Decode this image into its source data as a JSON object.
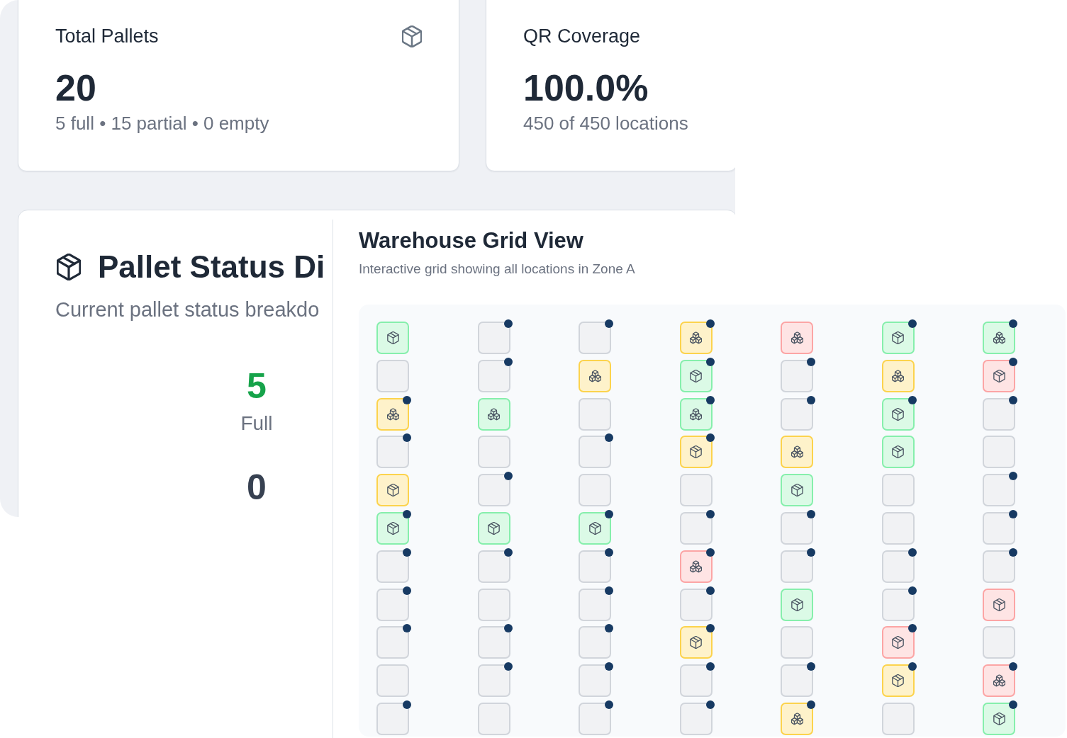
{
  "summary_cards": [
    {
      "title": "Total Pallets",
      "icon": true,
      "value": "20",
      "detail": "5 full • 15 partial • 0 empty"
    },
    {
      "title": "QR Coverage",
      "icon": false,
      "value": "100.0%",
      "detail": "450 of 450 locations"
    }
  ],
  "pallet_status": {
    "title": "Pallet Status Di",
    "subtitle": "Current pallet status breakdo",
    "stats": [
      {
        "value": "5",
        "label": "Full",
        "color": "#16a34a"
      },
      {
        "value": "0",
        "color": "#374151"
      }
    ]
  },
  "warehouse_grid": {
    "title": "Warehouse Grid View",
    "subtitle": "Interactive grid showing all locations in Zone A",
    "columns": [
      {
        "cells": [
          {
            "color": "#86efac",
            "kind": "box",
            "dot": false
          },
          {
            "color": "#d1d5db",
            "kind": "empty",
            "dot": false
          },
          {
            "color": "#fcd34d",
            "kind": "boxes",
            "dot": true
          },
          {
            "color": "#d1d5db",
            "kind": "empty",
            "dot": true
          },
          {
            "color": "#fcd34d",
            "kind": "box",
            "dot": false
          },
          {
            "color": "#86efac",
            "kind": "box",
            "dot": true
          },
          {
            "color": "#d1d5db",
            "kind": "empty",
            "dot": true
          },
          {
            "color": "#d1d5db",
            "kind": "empty",
            "dot": true
          },
          {
            "color": "#d1d5db",
            "kind": "empty",
            "dot": true
          },
          {
            "color": "#d1d5db",
            "kind": "empty",
            "dot": false
          },
          {
            "color": "#d1d5db",
            "kind": "empty",
            "dot": true
          }
        ]
      },
      {
        "cells": [
          {
            "color": "#d1d5db",
            "kind": "empty",
            "dot": true
          },
          {
            "color": "#d1d5db",
            "kind": "empty",
            "dot": true
          },
          {
            "color": "#86efac",
            "kind": "boxes",
            "dot": false
          },
          {
            "color": "#d1d5db",
            "kind": "empty",
            "dot": false
          },
          {
            "color": "#d1d5db",
            "kind": "empty",
            "dot": true
          },
          {
            "color": "#86efac",
            "kind": "box",
            "dot": false
          },
          {
            "color": "#d1d5db",
            "kind": "empty",
            "dot": true
          },
          {
            "color": "#d1d5db",
            "kind": "empty",
            "dot": false
          },
          {
            "color": "#d1d5db",
            "kind": "empty",
            "dot": true
          },
          {
            "color": "#d1d5db",
            "kind": "empty",
            "dot": true
          },
          {
            "color": "#d1d5db",
            "kind": "empty",
            "dot": false
          }
        ]
      },
      {
        "cells": [
          {
            "color": "#d1d5db",
            "kind": "empty",
            "dot": true
          },
          {
            "color": "#fcd34d",
            "kind": "boxes",
            "dot": false
          },
          {
            "color": "#d1d5db",
            "kind": "empty",
            "dot": false
          },
          {
            "color": "#d1d5db",
            "kind": "empty",
            "dot": true
          },
          {
            "color": "#d1d5db",
            "kind": "empty",
            "dot": false
          },
          {
            "color": "#86efac",
            "kind": "box",
            "dot": true
          },
          {
            "color": "#d1d5db",
            "kind": "empty",
            "dot": true
          },
          {
            "color": "#d1d5db",
            "kind": "empty",
            "dot": true
          },
          {
            "color": "#d1d5db",
            "kind": "empty",
            "dot": true
          },
          {
            "color": "#d1d5db",
            "kind": "empty",
            "dot": true
          },
          {
            "color": "#d1d5db",
            "kind": "empty",
            "dot": true
          }
        ]
      },
      {
        "cells": [
          {
            "color": "#fcd34d",
            "kind": "boxes",
            "dot": true
          },
          {
            "color": "#86efac",
            "kind": "box",
            "dot": true
          },
          {
            "color": "#86efac",
            "kind": "boxes",
            "dot": true
          },
          {
            "color": "#fcd34d",
            "kind": "box",
            "dot": true
          },
          {
            "color": "#d1d5db",
            "kind": "empty",
            "dot": false
          },
          {
            "color": "#d1d5db",
            "kind": "empty",
            "dot": true
          },
          {
            "color": "#fca5a5",
            "kind": "boxes",
            "dot": true
          },
          {
            "color": "#d1d5db",
            "kind": "empty",
            "dot": true
          },
          {
            "color": "#fcd34d",
            "kind": "box",
            "dot": true
          },
          {
            "color": "#d1d5db",
            "kind": "empty",
            "dot": true
          },
          {
            "color": "#d1d5db",
            "kind": "empty",
            "dot": true
          }
        ]
      },
      {
        "cells": [
          {
            "color": "#fca5a5",
            "kind": "boxes",
            "dot": false
          },
          {
            "color": "#d1d5db",
            "kind": "empty",
            "dot": true
          },
          {
            "color": "#d1d5db",
            "kind": "empty",
            "dot": true
          },
          {
            "color": "#fcd34d",
            "kind": "boxes",
            "dot": false
          },
          {
            "color": "#86efac",
            "kind": "box",
            "dot": false
          },
          {
            "color": "#d1d5db",
            "kind": "empty",
            "dot": true
          },
          {
            "color": "#d1d5db",
            "kind": "empty",
            "dot": true
          },
          {
            "color": "#86efac",
            "kind": "box",
            "dot": false
          },
          {
            "color": "#d1d5db",
            "kind": "empty",
            "dot": false
          },
          {
            "color": "#d1d5db",
            "kind": "empty",
            "dot": true
          },
          {
            "color": "#fcd34d",
            "kind": "boxes",
            "dot": true
          }
        ]
      },
      {
        "cells": [
          {
            "color": "#86efac",
            "kind": "box",
            "dot": true
          },
          {
            "color": "#fcd34d",
            "kind": "boxes",
            "dot": false
          },
          {
            "color": "#86efac",
            "kind": "box",
            "dot": true
          },
          {
            "color": "#86efac",
            "kind": "box",
            "dot": false
          },
          {
            "color": "#d1d5db",
            "kind": "empty",
            "dot": false
          },
          {
            "color": "#d1d5db",
            "kind": "empty",
            "dot": false
          },
          {
            "color": "#d1d5db",
            "kind": "empty",
            "dot": true
          },
          {
            "color": "#d1d5db",
            "kind": "empty",
            "dot": true
          },
          {
            "color": "#fca5a5",
            "kind": "box",
            "dot": true
          },
          {
            "color": "#fcd34d",
            "kind": "box",
            "dot": true
          },
          {
            "color": "#d1d5db",
            "kind": "empty",
            "dot": false
          }
        ]
      },
      {
        "cells": [
          {
            "color": "#86efac",
            "kind": "boxes",
            "dot": true
          },
          {
            "color": "#fca5a5",
            "kind": "box",
            "dot": true
          },
          {
            "color": "#d1d5db",
            "kind": "empty",
            "dot": true
          },
          {
            "color": "#d1d5db",
            "kind": "empty",
            "dot": false
          },
          {
            "color": "#d1d5db",
            "kind": "empty",
            "dot": true
          },
          {
            "color": "#d1d5db",
            "kind": "empty",
            "dot": true
          },
          {
            "color": "#d1d5db",
            "kind": "empty",
            "dot": true
          },
          {
            "color": "#fca5a5",
            "kind": "box",
            "dot": false
          },
          {
            "color": "#d1d5db",
            "kind": "empty",
            "dot": false
          },
          {
            "color": "#fca5a5",
            "kind": "boxes",
            "dot": true
          },
          {
            "color": "#86efac",
            "kind": "box",
            "dot": true
          }
        ]
      }
    ]
  }
}
